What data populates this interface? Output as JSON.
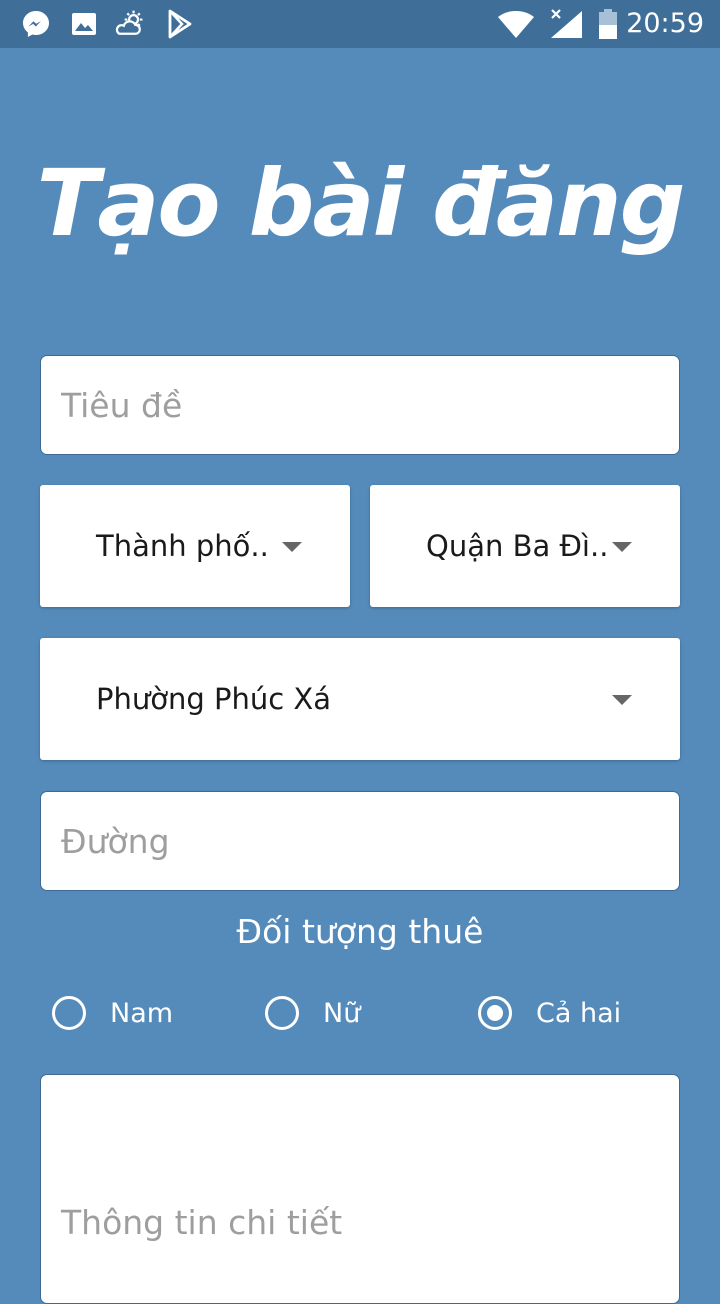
{
  "status_bar": {
    "time": "20:59",
    "left_icons": [
      "messenger-icon",
      "gallery-icon",
      "weather-icon",
      "play-store-icon"
    ],
    "right_icons": [
      "wifi-icon",
      "signal-icon",
      "battery-icon"
    ]
  },
  "header": {
    "title": "Tạo bài đăng"
  },
  "form": {
    "title_field": {
      "placeholder": "Tiêu đề",
      "value": ""
    },
    "city_select": {
      "value": "Thành phố.."
    },
    "district_select": {
      "value": "Quận Ba Đì.."
    },
    "ward_select": {
      "value": "Phường Phúc Xá"
    },
    "street_field": {
      "placeholder": "Đường",
      "value": ""
    },
    "tenant_section": {
      "label": "Đối tượng thuê",
      "options": [
        {
          "label": "Nam",
          "selected": false
        },
        {
          "label": "Nữ",
          "selected": false
        },
        {
          "label": "Cả hai",
          "selected": true
        }
      ]
    },
    "details_field": {
      "placeholder": "Thông tin chi tiết",
      "value": ""
    }
  },
  "colors": {
    "background": "#558bbb",
    "status_bar": "#3f6f99",
    "field_background": "#ffffff",
    "placeholder": "#9e9e9e"
  }
}
